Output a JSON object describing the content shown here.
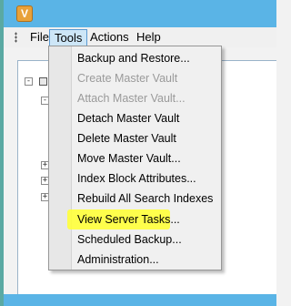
{
  "menubar": {
    "items": [
      {
        "label": "File"
      },
      {
        "label": "Tools"
      },
      {
        "label": "Actions"
      },
      {
        "label": "Help"
      }
    ],
    "active": "Tools"
  },
  "tools_menu": {
    "items": [
      {
        "label": "Backup and Restore...",
        "enabled": true
      },
      {
        "label": "Create Master Vault",
        "enabled": false
      },
      {
        "label": "Attach Master Vault...",
        "enabled": false
      },
      {
        "label": "Detach Master Vault",
        "enabled": true
      },
      {
        "label": "Delete Master Vault",
        "enabled": true
      },
      {
        "label": "Move Master Vault...",
        "enabled": true
      },
      {
        "label": "Index Block Attributes...",
        "enabled": true
      },
      {
        "label": "Rebuild All Search Indexes",
        "enabled": true
      },
      {
        "label": "View Server Tasks...",
        "enabled": true,
        "highlighted": true
      },
      {
        "label": "Scheduled Backup...",
        "enabled": true
      },
      {
        "label": "Administration...",
        "enabled": true
      }
    ],
    "highlight_color": "#ffff3a"
  },
  "tree": {
    "expanders": [
      "-",
      "-",
      "+",
      "+",
      "+"
    ]
  },
  "colors": {
    "titlebar": "#5ab4e6",
    "menu_active": "#cde6f7"
  }
}
